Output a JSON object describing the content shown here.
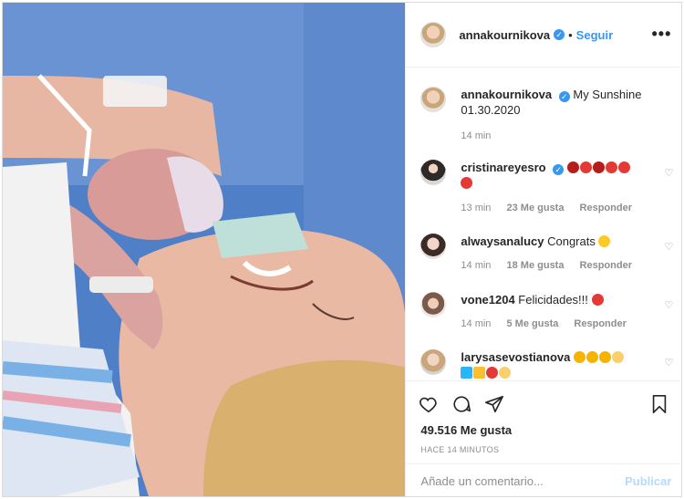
{
  "post": {
    "author": "annakournikova",
    "follow_label": "Seguir",
    "dot": "•",
    "more_icon": "more-icon"
  },
  "caption": {
    "user": "annakournikova",
    "text": "My Sunshine",
    "text2": "01.30.2020",
    "age": "14 min"
  },
  "comments": [
    {
      "user": "cristinareyesro",
      "text": "",
      "age": "13 min",
      "likes": "23 Me gusta",
      "reply": "Responder"
    },
    {
      "user": "alwaysanalucy",
      "text": "Congrats",
      "age": "14 min",
      "likes": "18 Me gusta",
      "reply": "Responder"
    },
    {
      "user": "vone1204",
      "text": "Felicidades!!!",
      "age": "14 min",
      "likes": "5 Me gusta",
      "reply": "Responder"
    },
    {
      "user": "larysasevostianova",
      "text": "",
      "age": "",
      "likes": "",
      "reply": ""
    }
  ],
  "footer": {
    "likes": "49.516 Me gusta",
    "time": "HACE 14 MINUTOS",
    "comment_placeholder": "Añade un comentario...",
    "publish_label": "Publicar"
  },
  "colors": {
    "accent": "#3897f0",
    "heart_red": "#e0245e"
  }
}
